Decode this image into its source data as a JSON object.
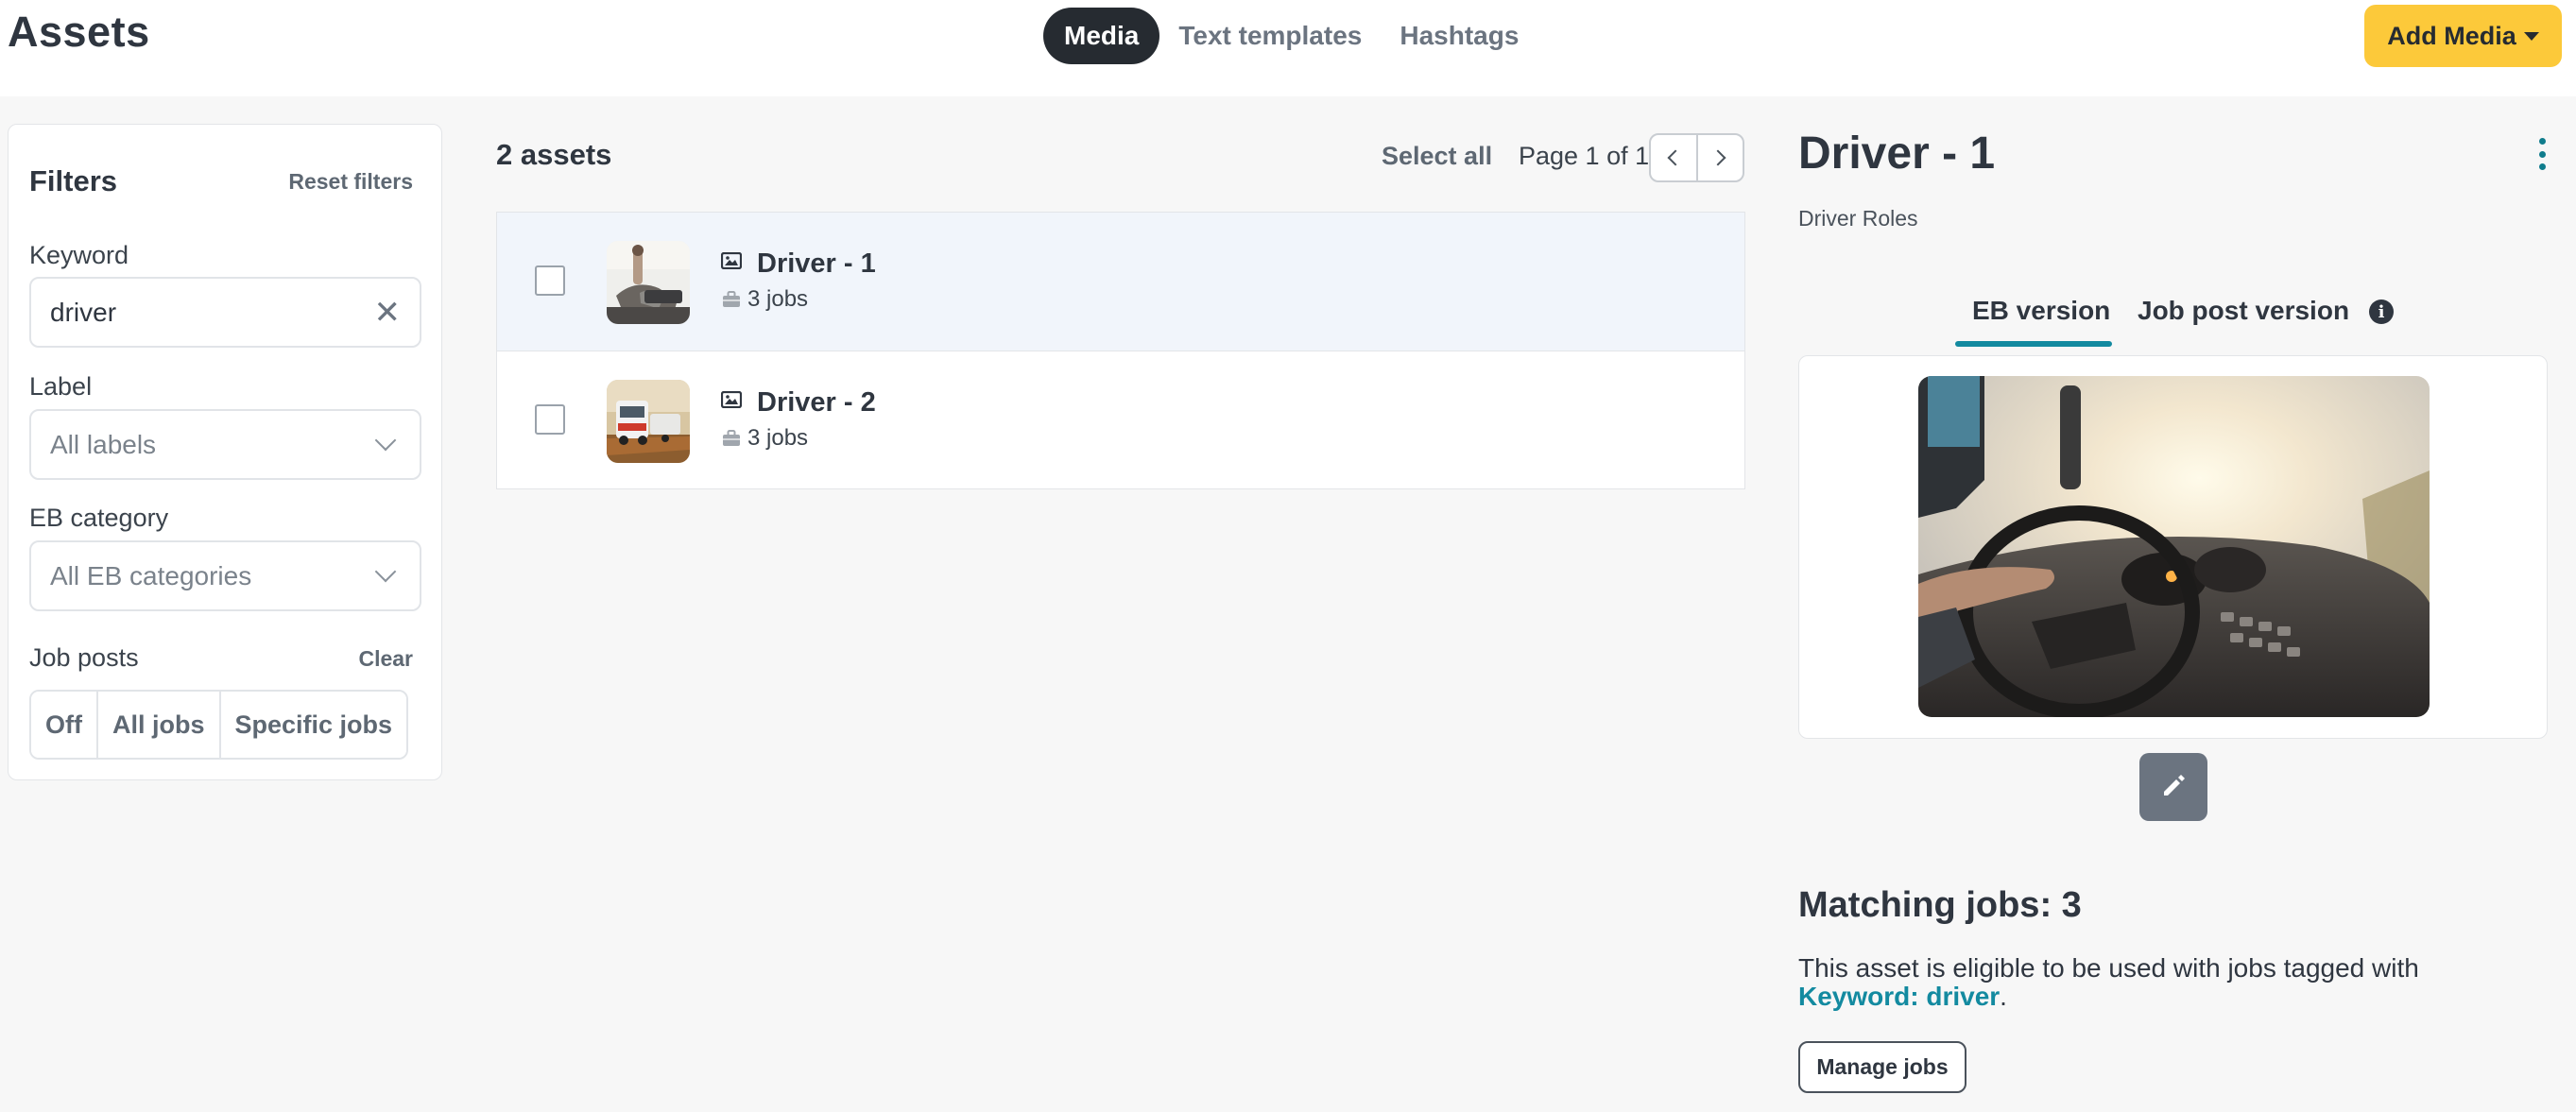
{
  "header": {
    "title": "Assets",
    "tabs": [
      {
        "label": "Media",
        "active": true
      },
      {
        "label": "Text templates",
        "active": false
      },
      {
        "label": "Hashtags",
        "active": false
      }
    ],
    "add_media_label": "Add Media"
  },
  "filters": {
    "title": "Filters",
    "reset_label": "Reset filters",
    "keyword": {
      "label": "Keyword",
      "value": "driver"
    },
    "label": {
      "label": "Label",
      "placeholder": "All labels"
    },
    "eb_category": {
      "label": "EB category",
      "placeholder": "All EB categories"
    },
    "job_posts": {
      "label": "Job posts",
      "clear_label": "Clear",
      "options": [
        "Off",
        "All jobs",
        "Specific jobs"
      ]
    }
  },
  "list": {
    "count_label": "2 assets",
    "select_all_label": "Select all",
    "page_info": "Page 1 of 1",
    "items": [
      {
        "title": "Driver - 1",
        "jobs": "3 jobs",
        "selected": true
      },
      {
        "title": "Driver - 2",
        "jobs": "3 jobs",
        "selected": false
      }
    ]
  },
  "detail": {
    "title": "Driver - 1",
    "subtitle": "Driver Roles",
    "version_tabs": [
      "EB version",
      "Job post version"
    ],
    "active_version": "EB version",
    "matching_jobs": "Matching jobs: 3",
    "eligible_text": "This asset is eligible to be used with jobs tagged with",
    "keyword_link": "Keyword: driver",
    "period": ".",
    "manage_jobs_label": "Manage jobs"
  },
  "colors": {
    "accent_yellow": "#fcc93a",
    "accent_teal": "#138aa0",
    "dark": "#262b31"
  }
}
